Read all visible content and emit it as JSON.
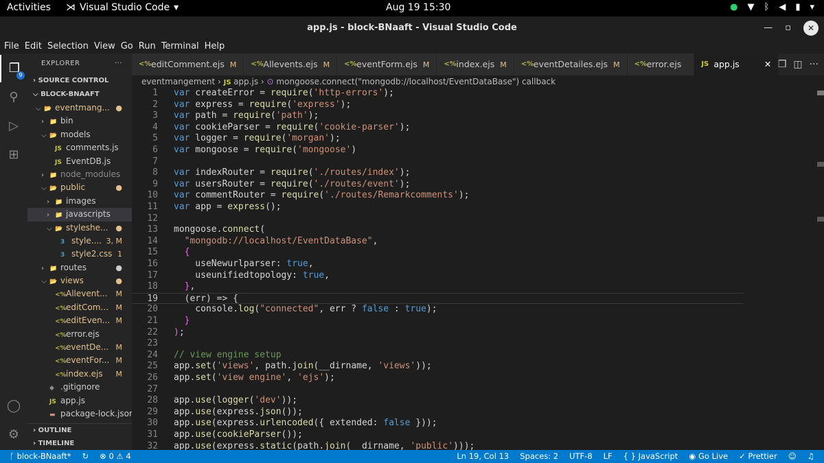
{
  "topbar": {
    "activities": "Activities",
    "app_name": "Visual Studio Code",
    "clock": "Aug 19  15:30"
  },
  "window": {
    "title": "app.js - block-BNaaft - Visual Studio Code"
  },
  "menu": [
    "File",
    "Edit",
    "Selection",
    "View",
    "Go",
    "Run",
    "Terminal",
    "Help"
  ],
  "activity_badge": "9",
  "explorer": {
    "title": "EXPLORER",
    "source_control": "SOURCE CONTROL",
    "project": "BLOCK-BNAAFT",
    "tree": [
      {
        "arrow": "⌵",
        "icon": "📂",
        "label": "eventmang...",
        "status": "●",
        "indent": 1,
        "cls": "c-yel",
        "icls": "c-yel"
      },
      {
        "arrow": "›",
        "icon": "📁",
        "label": "bin",
        "status": "",
        "indent": 2,
        "cls": "",
        "icls": "c-yel"
      },
      {
        "arrow": "⌵",
        "icon": "📂",
        "label": "models",
        "status": "",
        "indent": 2,
        "cls": "",
        "icls": "css"
      },
      {
        "arrow": "",
        "icon": "JS",
        "label": "comments.js",
        "status": "",
        "indent": 3,
        "cls": "",
        "icls": "js"
      },
      {
        "arrow": "",
        "icon": "JS",
        "label": "EventDB.js",
        "status": "",
        "indent": 3,
        "cls": "",
        "icls": "js"
      },
      {
        "arrow": "›",
        "icon": "📁",
        "label": "node_modules",
        "status": "",
        "indent": 2,
        "cls": "c-gray",
        "icls": "c-grn"
      },
      {
        "arrow": "⌵",
        "icon": "📂",
        "label": "public",
        "status": "●",
        "indent": 2,
        "cls": "c-yel",
        "icls": "c-grn"
      },
      {
        "arrow": "›",
        "icon": "📁",
        "label": "images",
        "status": "",
        "indent": 3,
        "cls": "",
        "icls": "c-yel"
      },
      {
        "arrow": "›",
        "icon": "📁",
        "label": "javascripts",
        "status": "",
        "indent": 3,
        "cls": "",
        "icls": "c-yel",
        "sel": true
      },
      {
        "arrow": "⌵",
        "icon": "📂",
        "label": "styleshe...",
        "status": "●",
        "indent": 3,
        "cls": "c-yel",
        "icls": "c-yel"
      },
      {
        "arrow": "",
        "icon": "3",
        "label": "style....",
        "status": "3, M",
        "indent": 4,
        "cls": "c-yel",
        "icls": "css"
      },
      {
        "arrow": "",
        "icon": "3",
        "label": "style2.css",
        "status": "1",
        "indent": 4,
        "cls": "c-yel",
        "icls": "css"
      },
      {
        "arrow": "›",
        "icon": "📁",
        "label": "routes",
        "status": "●",
        "indent": 2,
        "cls": "",
        "icls": "c-grn"
      },
      {
        "arrow": "⌵",
        "icon": "📂",
        "label": "views",
        "status": "●",
        "indent": 2,
        "cls": "c-yel",
        "icls": "c-yel"
      },
      {
        "arrow": "",
        "icon": "<%",
        "label": "Allevent...",
        "status": "M",
        "indent": 3,
        "cls": "c-yel",
        "icls": "ejs"
      },
      {
        "arrow": "",
        "icon": "<%",
        "label": "editCom...",
        "status": "M",
        "indent": 3,
        "cls": "c-yel",
        "icls": "ejs"
      },
      {
        "arrow": "",
        "icon": "<%",
        "label": "editEven...",
        "status": "M",
        "indent": 3,
        "cls": "c-yel",
        "icls": "ejs"
      },
      {
        "arrow": "",
        "icon": "<%",
        "label": "error.ejs",
        "status": "",
        "indent": 3,
        "cls": "",
        "icls": "ejs"
      },
      {
        "arrow": "",
        "icon": "<%",
        "label": "eventDe...",
        "status": "M",
        "indent": 3,
        "cls": "c-yel",
        "icls": "ejs"
      },
      {
        "arrow": "",
        "icon": "<%",
        "label": "eventFor...",
        "status": "M",
        "indent": 3,
        "cls": "c-yel",
        "icls": "ejs"
      },
      {
        "arrow": "",
        "icon": "<%",
        "label": "index.ejs",
        "status": "M",
        "indent": 3,
        "cls": "c-yel",
        "icls": "ejs"
      },
      {
        "arrow": "",
        "icon": "◆",
        "label": ".gitignore",
        "status": "",
        "indent": 2,
        "cls": "",
        "icls": "c-gray"
      },
      {
        "arrow": "",
        "icon": "JS",
        "label": "app.js",
        "status": "",
        "indent": 2,
        "cls": "",
        "icls": "js"
      },
      {
        "arrow": "",
        "icon": "▬",
        "label": "package-lock.json",
        "status": "",
        "indent": 2,
        "cls": "",
        "icls": "str"
      }
    ],
    "outline": "OUTLINE",
    "timeline": "TIMELINE"
  },
  "tabs": [
    {
      "icon": "<%",
      "label": "editComment.ejs",
      "mark": "M"
    },
    {
      "icon": "<%",
      "label": "Allevents.ejs",
      "mark": "M"
    },
    {
      "icon": "<%",
      "label": "eventForm.ejs",
      "mark": "M"
    },
    {
      "icon": "<%",
      "label": "index.ejs",
      "mark": "M"
    },
    {
      "icon": "<%",
      "label": "eventDetailes.ejs",
      "mark": "M"
    },
    {
      "icon": "<%",
      "label": "error.ejs",
      "mark": ""
    },
    {
      "icon": "JS",
      "label": "app.js",
      "mark": "",
      "active": true
    }
  ],
  "breadcrumb": {
    "folder": "eventmangement",
    "file": "app.js",
    "symbol": "mongoose.connect(\"mongodb://localhost/EventDataBase\") callback"
  },
  "code_lines": [
    "var createError = require('http-errors');",
    "var express = require('express');",
    "var path = require('path');",
    "var cookieParser = require('cookie-parser');",
    "var logger = require('morgan');",
    "var mongoose = require('mongoose')",
    "",
    "var indexRouter = require('./routes/index');",
    "var usersRouter = require('./routes/event');",
    "var commentRouter = require('./routes/Remarkcomments');",
    "var app = express();",
    "",
    "mongoose.connect(",
    "  \"mongodb://localhost/EventDataBase\",",
    "  {",
    "    useNewurlparser: true,",
    "    useunifiedtopology: true,",
    "  },",
    "  (err) => {",
    "    console.log(\"connected\", err ? false : true);",
    "  }",
    ");",
    "",
    "// view engine setup",
    "app.set('views', path.join(__dirname, 'views'));",
    "app.set('view engine', 'ejs');",
    "",
    "app.use(logger('dev'));",
    "app.use(express.json());",
    "app.use(express.urlencoded({ extended: false }));",
    "app.use(cookieParser());",
    "app.use(express.static(path.join(__dirname, 'public')));"
  ],
  "current_line": 19,
  "status": {
    "branch": "block-BNaaft*",
    "problems": "⊗ 0 ⚠ 4",
    "position": "Ln 19, Col 13",
    "spaces": "Spaces: 2",
    "encoding": "UTF-8",
    "eol": "LF",
    "language": "JavaScript",
    "golive": "Go Live",
    "prettier": "Prettier"
  }
}
